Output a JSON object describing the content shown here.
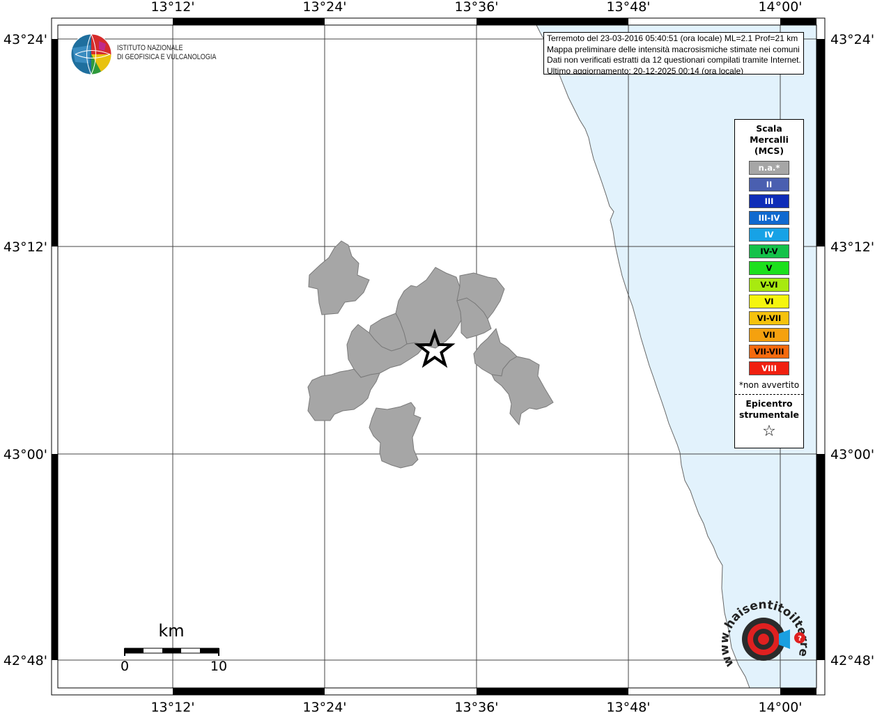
{
  "map": {
    "lon_ticks": [
      "13°12'",
      "13°24'",
      "13°36'",
      "13°48'",
      "14°00'"
    ],
    "lat_ticks": [
      "43°24'",
      "43°12'",
      "43°00'",
      "42°48'"
    ]
  },
  "info": {
    "lines": [
      "Terremoto del 23-03-2016 05:40:51 (ora locale) ML=2.1 Prof=21 km",
      "Mappa preliminare delle intensità macrosismiche stimate nei comuni",
      "Dati non verificati estratti da 12 questionari compilati tramite Internet.",
      "Ultimo aggiornamento: 20-12-2025 00:14 (ora locale)"
    ]
  },
  "legend": {
    "title": [
      "Scala",
      "Mercalli",
      "(MCS)"
    ],
    "items": [
      {
        "label": "n.a.*",
        "color": "#a6a6a6",
        "text_color": "#ffffff"
      },
      {
        "label": "II",
        "color": "#4a5fb0",
        "text_color": "#ffffff"
      },
      {
        "label": "III",
        "color": "#0f2db8",
        "text_color": "#ffffff"
      },
      {
        "label": "III-IV",
        "color": "#1069cf",
        "text_color": "#ffffff"
      },
      {
        "label": "IV",
        "color": "#17a2e6",
        "text_color": "#ffffff"
      },
      {
        "label": "IV-V",
        "color": "#14c24a",
        "text_color": "#000000"
      },
      {
        "label": "V",
        "color": "#1de01d",
        "text_color": "#000000"
      },
      {
        "label": "V-VI",
        "color": "#a8ea10",
        "text_color": "#000000"
      },
      {
        "label": "VI",
        "color": "#f5f50e",
        "text_color": "#000000"
      },
      {
        "label": "VI-VII",
        "color": "#f5c20e",
        "text_color": "#000000"
      },
      {
        "label": "VII",
        "color": "#f5a10e",
        "text_color": "#000000"
      },
      {
        "label": "VII-VIII",
        "color": "#f56a0e",
        "text_color": "#000000"
      },
      {
        "label": "VIII",
        "color": "#f02010",
        "text_color": "#ffffff"
      }
    ],
    "note": "*non avvertito",
    "epicenter": [
      "Epicentro",
      "strumentale"
    ]
  },
  "scalebar": {
    "unit": "km",
    "min": "0",
    "max": "10"
  },
  "logos": {
    "ingv": [
      "ISTITUTO NAZIONALE",
      "DI GEOFISICA E VULCANOLOGIA"
    ],
    "hsit": "www.haisentitoilterremoto.it"
  },
  "colors": {
    "sea": "#e2f2fc",
    "felt_area": "#a6a6a6"
  }
}
